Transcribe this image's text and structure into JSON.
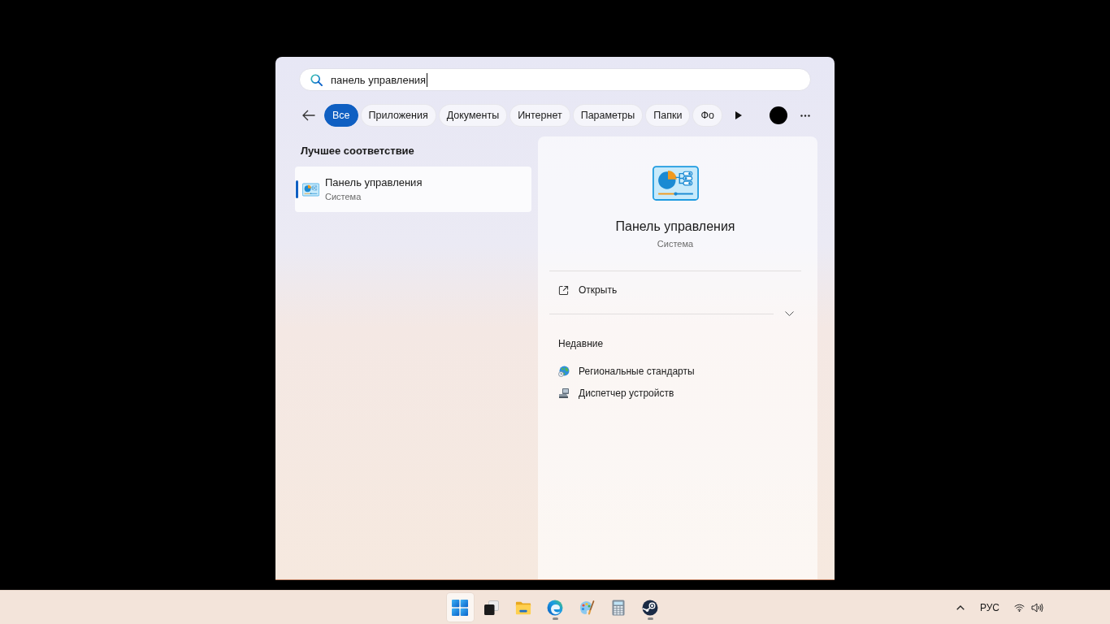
{
  "search": {
    "value": "панель управления"
  },
  "filters": {
    "tabs": [
      {
        "label": "Все",
        "selected": true
      },
      {
        "label": "Приложения",
        "selected": false
      },
      {
        "label": "Документы",
        "selected": false
      },
      {
        "label": "Интернет",
        "selected": false
      },
      {
        "label": "Параметры",
        "selected": false
      },
      {
        "label": "Папки",
        "selected": false
      },
      {
        "label": "Фо",
        "selected": false
      }
    ]
  },
  "best_match": {
    "heading": "Лучшее соответствие",
    "results": [
      {
        "title": "Панель управления",
        "subtitle": "Система",
        "selected": true
      }
    ]
  },
  "details": {
    "title": "Панель управления",
    "subtitle": "Система",
    "actions": [
      {
        "label": "Открыть"
      }
    ],
    "expanded": false,
    "recent_heading": "Недавние",
    "recent": [
      {
        "label": "Региональные стандарты",
        "kind": "globe"
      },
      {
        "label": "Диспетчер устройств",
        "kind": "device"
      }
    ]
  },
  "taskbar": {
    "apps": [
      {
        "kind": "start",
        "selected": true,
        "running": false
      },
      {
        "kind": "task_view",
        "selected": false,
        "running": false
      },
      {
        "kind": "files",
        "selected": false,
        "running": false
      },
      {
        "kind": "browser",
        "selected": false,
        "running": true
      },
      {
        "kind": "paint",
        "selected": false,
        "running": false
      },
      {
        "kind": "calculator",
        "selected": false,
        "running": false
      },
      {
        "kind": "game_store",
        "selected": false,
        "running": true
      }
    ],
    "tray": {
      "language": "РУС"
    }
  }
}
